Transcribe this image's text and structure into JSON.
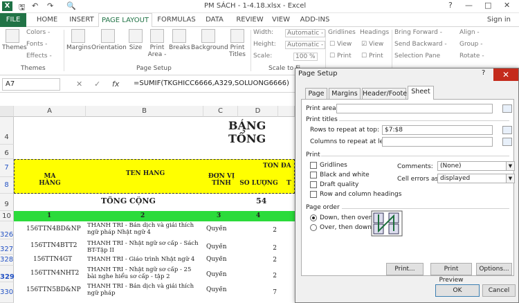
{
  "titlebar": {
    "title": "PM SÁCH - 1-4.18.xlsx - Excel",
    "help": "?",
    "min": "—",
    "max": "□",
    "close": "✕",
    "qat_save": "🖫",
    "qat_undo": "↶",
    "qat_redo": "↷",
    "qat_preview": "🔍"
  },
  "tabs": {
    "file": "FILE",
    "home": "HOME",
    "insert": "INSERT",
    "page_layout": "PAGE LAYOUT",
    "formulas": "FORMULAS",
    "data": "DATA",
    "review": "REVIEW",
    "view": "VIEW",
    "addins": "ADD-INS",
    "signin": "Sign in"
  },
  "ribbon": {
    "themes": "Themes",
    "colors": "Colors -",
    "fonts": "Fonts -",
    "effects": "Effects -",
    "margins": "Margins",
    "orientation": "Orientation",
    "size": "Size",
    "print_area": "Print Area -",
    "breaks": "Breaks",
    "background": "Background",
    "print_titles": "Print Titles",
    "width_lbl": "Width:",
    "width_val": "Automatic -",
    "height_lbl": "Height:",
    "height_val": "Automatic -",
    "scale_lbl": "Scale:",
    "scale_val": "100 %",
    "gridlines": "Gridlines",
    "headings": "Headings",
    "view1": "View",
    "view2": "View",
    "print1": "Print",
    "print2": "Print",
    "bring_forward": "Bring Forward -",
    "send_backward": "Send Backward -",
    "selection_pane": "Selection Pane",
    "align": "Align -",
    "group": "Group -",
    "rotate": "Rotate -",
    "grp_themes": "Themes",
    "grp_page_setup": "Page Setup",
    "grp_scale": "Scale to Fi"
  },
  "formula_bar": {
    "name_box": "A7",
    "cancel": "✕",
    "enter": "✓",
    "fx": "fx",
    "formula": "=SUMIF(TKGHICC6666,A329,SOLUONG6666)"
  },
  "columns": [
    "A",
    "B",
    "C",
    "D"
  ],
  "sheet": {
    "title": "BẢNG TỔNG",
    "hdr_ma": "MÃ HÀNG",
    "hdr_ten": "TÊN HÀNG",
    "hdr_donvi": "ĐƠN VỊ TÍNH",
    "hdr_ton": "TỒN ĐẦ",
    "hdr_soluong": "SỐ LƯỢNG",
    "hdr_t": "T",
    "tong_cong": "TỔNG CỘNG",
    "tong_val": "54",
    "num_a": "1",
    "num_b": "2",
    "num_c": "3",
    "num_d": "4",
    "rows": [
      {
        "r": "326",
        "ma": "156TTN4BD&NP",
        "ten": "THANH TRÌ - Bản dịch và giải thích ngữ pháp Nhật ngữ 4",
        "dv": "Quyển",
        "sl": "2"
      },
      {
        "r": "327",
        "ma": "156TTN4BTT2",
        "ten": "THANH TRÌ - Nhật ngữ sơ cấp - Sách BT-Tập II",
        "dv": "Quyển",
        "sl": "2"
      },
      {
        "r": "328",
        "ma": "156TTN4GT",
        "ten": "THANH TRÌ - Giáo trình Nhật ngữ 4",
        "dv": "Quyển",
        "sl": "2"
      },
      {
        "r": "329",
        "ma": "156TTN4NHT2",
        "ten": "THANH TRÌ - Nhật ngữ sơ cấp - 25 bài nghe hiểu sơ cấp - tập 2",
        "dv": "Quyển",
        "sl": "2"
      },
      {
        "r": "330",
        "ma": "156TTN5BD&NP",
        "ten": "THANH TRÌ - Bản dịch và giải thích ngữ pháp",
        "dv": "Quyển",
        "sl": "7"
      }
    ],
    "row_nums": [
      "4",
      "6",
      "7",
      "8",
      "9",
      "10"
    ]
  },
  "dialog": {
    "title": "Page Setup",
    "help": "?",
    "close": "✕",
    "tabs": [
      "Page",
      "Margins",
      "Header/Footer",
      "Sheet"
    ],
    "print_area": "Print area:",
    "print_titles": "Print titles",
    "rows_repeat": "Rows to repeat at top:",
    "rows_repeat_val": "$7:$8",
    "cols_repeat": "Columns to repeat at left:",
    "print": "Print",
    "gridlines": "Gridlines",
    "black_white": "Black and white",
    "draft": "Draft quality",
    "row_col_head": "Row and column headings",
    "comments": "Comments:",
    "comments_val": "(None)",
    "cell_errors": "Cell errors as:",
    "cell_errors_val": "displayed",
    "page_order": "Page order",
    "down_over": "Down, then over",
    "over_down": "Over, then down",
    "btn_print": "Print...",
    "btn_preview": "Print Preview",
    "btn_options": "Options...",
    "btn_ok": "OK",
    "btn_cancel": "Cancel"
  }
}
